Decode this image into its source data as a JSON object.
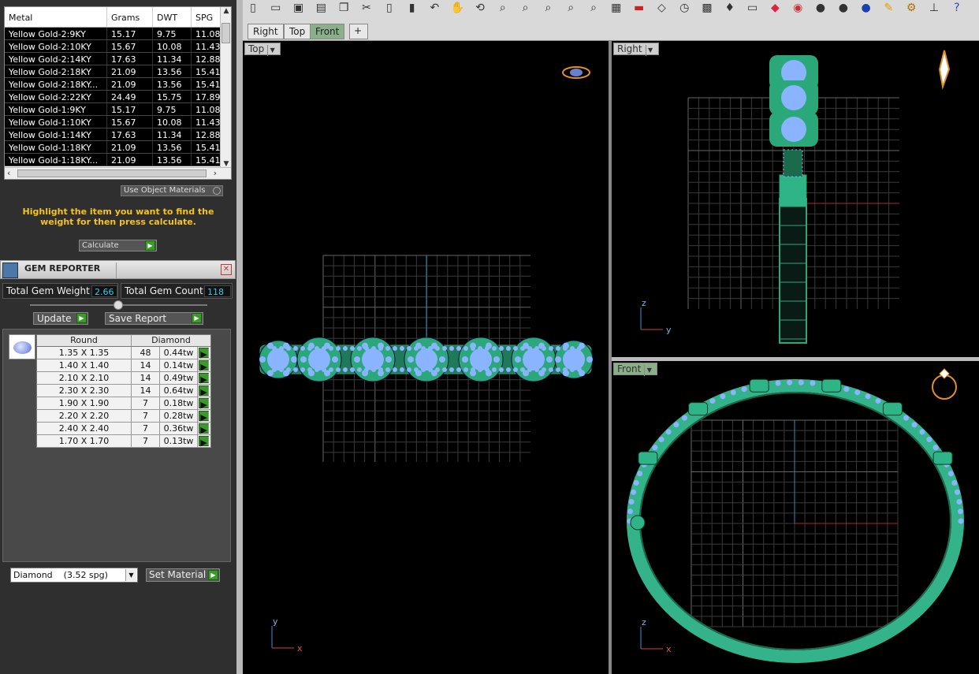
{
  "metal_table": {
    "columns": [
      "Metal",
      "Grams",
      "DWT",
      "SPG"
    ],
    "rows": [
      [
        "Yellow Gold-2:9KY",
        "15.17",
        "9.75",
        "11.08"
      ],
      [
        "Yellow Gold-2:10KY",
        "15.67",
        "10.08",
        "11.43"
      ],
      [
        "Yellow Gold-2:14KY",
        "17.63",
        "11.34",
        "12.88"
      ],
      [
        "Yellow Gold-2:18KY",
        "21.09",
        "13.56",
        "15.41"
      ],
      [
        "Yellow Gold-2:18KY...",
        "21.09",
        "13.56",
        "15.41"
      ],
      [
        "Yellow Gold-2:22KY",
        "24.49",
        "15.75",
        "17.89"
      ],
      [
        "Yellow Gold-1:9KY",
        "15.17",
        "9.75",
        "11.08"
      ],
      [
        "Yellow Gold-1:10KY",
        "15.67",
        "10.08",
        "11.43"
      ],
      [
        "Yellow Gold-1:14KY",
        "17.63",
        "11.34",
        "12.88"
      ],
      [
        "Yellow Gold-1:18KY",
        "21.09",
        "13.56",
        "15.41"
      ],
      [
        "Yellow Gold-1:18KY...",
        "21.09",
        "13.56",
        "15.41"
      ]
    ]
  },
  "use_object_materials": "Use Object Materials",
  "hint": "Highlight the item you want to find the weight for then press calculate.",
  "calculate_label": "Calculate",
  "gem_reporter": {
    "title": "GEM REPORTER",
    "total_weight_label": "Total Gem Weight",
    "total_weight_value": "2.66",
    "total_count_label": "Total Gem Count",
    "total_count_value": "118",
    "update_label": "Update",
    "save_report_label": "Save Report",
    "table_headers": [
      "Round",
      "Diamond"
    ],
    "rows": [
      [
        "1.35 X 1.35",
        "48",
        "0.44tw"
      ],
      [
        "1.40 X 1.40",
        "14",
        "0.14tw"
      ],
      [
        "2.10 X 2.10",
        "14",
        "0.49tw"
      ],
      [
        "2.30 X 2.30",
        "14",
        "0.64tw"
      ],
      [
        "1.90 X 1.90",
        "7",
        "0.18tw"
      ],
      [
        "2.20 X 2.20",
        "7",
        "0.28tw"
      ],
      [
        "2.40 X 2.40",
        "7",
        "0.36tw"
      ],
      [
        "1.70 X 1.70",
        "7",
        "0.13tw"
      ]
    ],
    "material_select": "Diamond    (3.52 spg)",
    "set_material_label": "Set Material"
  },
  "tabs": [
    "Right",
    "Top",
    "Front"
  ],
  "active_tab": "Front",
  "viewports": {
    "top": {
      "label": "Top",
      "axis_a": "y",
      "axis_b": "x"
    },
    "right": {
      "label": "Right",
      "axis_a": "z",
      "axis_b": "y"
    },
    "front": {
      "label": "Front",
      "axis_a": "z",
      "axis_b": "x"
    }
  },
  "colors": {
    "ring": "#2aa87a",
    "gem": "#8ab4ff",
    "accent_green": "#3a9a2a",
    "hint": "#f6c21d",
    "value": "#3ec6e6"
  },
  "toolbar_icons": [
    "new-file-icon",
    "open-folder-icon",
    "save-icon",
    "print-icon",
    "copy-icon",
    "cut-icon",
    "paste-icon",
    "clipboard-icon",
    "undo-icon",
    "pan-hand-icon",
    "rotate-icon",
    "zoom-icon",
    "zoom-window-icon",
    "zoom-extents-icon",
    "zoom-selected-icon",
    "zoom-dynamic-icon",
    "four-viewports-icon",
    "car-icon",
    "plane-icon",
    "clock-icon",
    "grid-snap-icon",
    "light-bulb-icon",
    "lock-icon",
    "layer-icon",
    "color-wheel-icon",
    "sphere-gray-icon",
    "sphere-shiny-icon",
    "sphere-blue-icon",
    "pencil-icon",
    "gear-icon",
    "dimension-icon",
    "help-icon"
  ]
}
